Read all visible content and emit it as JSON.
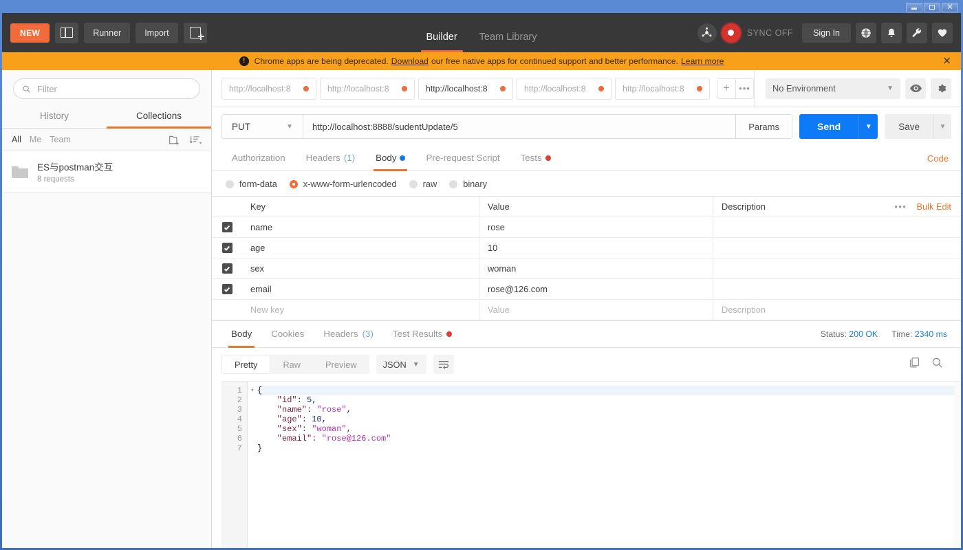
{
  "window": {
    "minimize_label": "Minimize",
    "maximize_label": "Restore",
    "close_label": "Close"
  },
  "topbar": {
    "new_label": "NEW",
    "runner_label": "Runner",
    "import_label": "Import",
    "sidebar_toggle_name": "sidebar-layout-toggle",
    "new_tab_name": "new-tab-button",
    "main_tabs": [
      {
        "label": "Builder",
        "active": true
      },
      {
        "label": "Team Library",
        "active": false
      }
    ],
    "sync_label": "SYNC OFF",
    "signin_label": "Sign In",
    "icons": [
      "interceptor-icon",
      "sync-status-icon",
      "globe-icon",
      "bell-icon",
      "wrench-icon",
      "heart-icon"
    ]
  },
  "banner": {
    "text_before": "Chrome apps are being deprecated.",
    "link1": "Download",
    "text_mid": "our free native apps for continued support and better performance.",
    "link2": "Learn more",
    "close_label": "✕",
    "bg_color": "#f9a01b"
  },
  "sidebar": {
    "filter_placeholder": "Filter",
    "filter_value": "",
    "tabs": [
      {
        "label": "History",
        "active": false
      },
      {
        "label": "Collections",
        "active": true
      }
    ],
    "scopes": [
      {
        "label": "All",
        "active": true
      },
      {
        "label": "Me",
        "active": false
      },
      {
        "label": "Team",
        "active": false
      }
    ],
    "new_folder_icon": "new-folder-icon",
    "sort_icon": "sort-icon",
    "collections": [
      {
        "name": "ES与postman交互",
        "meta": "8 requests"
      }
    ]
  },
  "tabstrip": {
    "tabs": [
      {
        "label": "http://localhost:8",
        "active": false,
        "unsaved": true
      },
      {
        "label": "http://localhost:8",
        "active": false,
        "unsaved": true
      },
      {
        "label": "http://localhost:8",
        "active": true,
        "unsaved": true
      },
      {
        "label": "http://localhost:8",
        "active": false,
        "unsaved": true
      },
      {
        "label": "http://localhost:8",
        "active": false,
        "unsaved": true
      }
    ],
    "add_label": "+",
    "more_label": "•••"
  },
  "environment": {
    "selected": "No Environment",
    "eye_icon": "eye-icon",
    "gear_icon": "gear-icon"
  },
  "request": {
    "method": "PUT",
    "url": "http://localhost:8888/sudentUpdate/5",
    "params_label": "Params",
    "send_label": "Send",
    "save_label": "Save",
    "code_label": "Code",
    "tabs": [
      {
        "label": "Authorization",
        "active": false,
        "count": "",
        "dot": ""
      },
      {
        "label": "Headers",
        "active": false,
        "count": "(1)",
        "dot": ""
      },
      {
        "label": "Body",
        "active": true,
        "count": "",
        "dot": "blue"
      },
      {
        "label": "Pre-request Script",
        "active": false,
        "count": "",
        "dot": ""
      },
      {
        "label": "Tests",
        "active": false,
        "count": "",
        "dot": "red"
      }
    ],
    "body_types": [
      {
        "label": "form-data",
        "selected": false
      },
      {
        "label": "x-www-form-urlencoded",
        "selected": true
      },
      {
        "label": "raw",
        "selected": false
      },
      {
        "label": "binary",
        "selected": false
      }
    ],
    "table": {
      "headers": {
        "key": "Key",
        "value": "Value",
        "description": "Description"
      },
      "bulk_edit_label": "Bulk Edit",
      "more_label": "•••",
      "rows": [
        {
          "checked": true,
          "key": "name",
          "value": "rose",
          "description": ""
        },
        {
          "checked": true,
          "key": "age",
          "value": "10",
          "description": ""
        },
        {
          "checked": true,
          "key": "sex",
          "value": "woman",
          "description": ""
        },
        {
          "checked": true,
          "key": "email",
          "value": "rose@126.com",
          "description": ""
        }
      ],
      "new_row": {
        "key_placeholder": "New key",
        "value_placeholder": "Value",
        "description_placeholder": "Description"
      }
    }
  },
  "response": {
    "tabs": [
      {
        "label": "Body",
        "active": true,
        "count": "",
        "dot": ""
      },
      {
        "label": "Cookies",
        "active": false,
        "count": "",
        "dot": ""
      },
      {
        "label": "Headers",
        "active": false,
        "count": "(3)",
        "dot": ""
      },
      {
        "label": "Test Results",
        "active": false,
        "count": "",
        "dot": "red"
      }
    ],
    "status_label": "Status:",
    "status_value": "200 OK",
    "time_label": "Time:",
    "time_value": "2340 ms",
    "view_modes": [
      {
        "label": "Pretty",
        "active": true
      },
      {
        "label": "Raw",
        "active": false
      },
      {
        "label": "Preview",
        "active": false
      }
    ],
    "format": "JSON",
    "wrap_icon": "wrap-lines-icon",
    "copy_icon": "copy-icon",
    "search_icon": "search-icon",
    "code_lines": [
      {
        "num": "1",
        "fold": "▾",
        "highlight": true,
        "tokens": [
          {
            "t": "{",
            "c": "p"
          }
        ]
      },
      {
        "num": "2",
        "fold": "",
        "highlight": false,
        "tokens": [
          {
            "t": "    \"id\"",
            "c": "k"
          },
          {
            "t": ": ",
            "c": "p"
          },
          {
            "t": "5",
            "c": "n"
          },
          {
            "t": ",",
            "c": "p"
          }
        ]
      },
      {
        "num": "3",
        "fold": "",
        "highlight": false,
        "tokens": [
          {
            "t": "    \"name\"",
            "c": "k"
          },
          {
            "t": ": ",
            "c": "p"
          },
          {
            "t": "\"rose\"",
            "c": "s"
          },
          {
            "t": ",",
            "c": "p"
          }
        ]
      },
      {
        "num": "4",
        "fold": "",
        "highlight": false,
        "tokens": [
          {
            "t": "    \"age\"",
            "c": "k"
          },
          {
            "t": ": ",
            "c": "p"
          },
          {
            "t": "10",
            "c": "n"
          },
          {
            "t": ",",
            "c": "p"
          }
        ]
      },
      {
        "num": "5",
        "fold": "",
        "highlight": false,
        "tokens": [
          {
            "t": "    \"sex\"",
            "c": "k"
          },
          {
            "t": ": ",
            "c": "p"
          },
          {
            "t": "\"woman\"",
            "c": "s"
          },
          {
            "t": ",",
            "c": "p"
          }
        ]
      },
      {
        "num": "6",
        "fold": "",
        "highlight": false,
        "tokens": [
          {
            "t": "    \"email\"",
            "c": "k"
          },
          {
            "t": ": ",
            "c": "p"
          },
          {
            "t": "\"rose@126.com\"",
            "c": "s"
          }
        ]
      },
      {
        "num": "7",
        "fold": "",
        "highlight": false,
        "tokens": [
          {
            "t": "}",
            "c": "p"
          }
        ]
      }
    ]
  },
  "colors": {
    "accent_orange": "#e8792b",
    "new_orange": "#f26b3a",
    "send_blue": "#0d7bf7",
    "banner": "#f9a01b",
    "topbar_dark": "#383838"
  }
}
